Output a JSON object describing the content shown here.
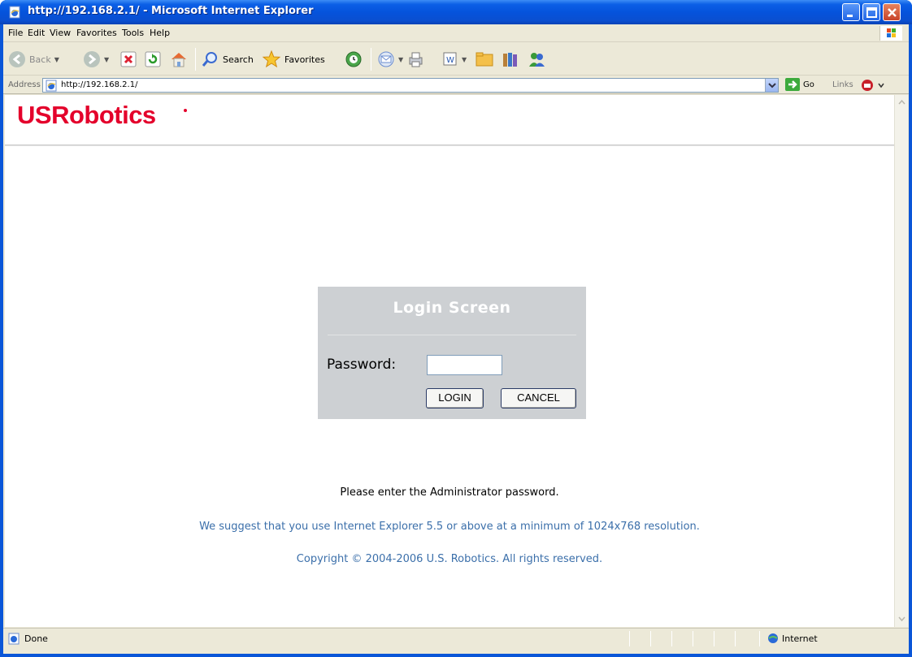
{
  "window": {
    "title": "http://192.168.2.1/ - Microsoft Internet Explorer"
  },
  "menu": {
    "items": [
      "File",
      "Edit",
      "View",
      "Favorites",
      "Tools",
      "Help"
    ]
  },
  "toolbar": {
    "back_label": "Back",
    "search_label": "Search",
    "favorites_label": "Favorites"
  },
  "address": {
    "label": "Address",
    "url": "http://192.168.2.1/",
    "go_label": "Go",
    "links_label": "Links"
  },
  "page": {
    "brand": "USRobotics",
    "login": {
      "title": "Login  Screen",
      "password_label": "Password:",
      "password_value": "",
      "login_button": "LOGIN",
      "cancel_button": "CANCEL"
    },
    "instruction": "Please enter the Administrator password.",
    "suggestion": "We suggest that you use Internet Explorer 5.5 or above at a minimum of 1024x768 resolution.",
    "copyright": "Copyright © 2004-2006 U.S. Robotics. All rights reserved."
  },
  "status": {
    "text": "Done",
    "zone": "Internet"
  },
  "colors": {
    "brand_red": "#e4002b",
    "link_blue": "#3b6faa",
    "login_panel": "#cdd0d3"
  }
}
